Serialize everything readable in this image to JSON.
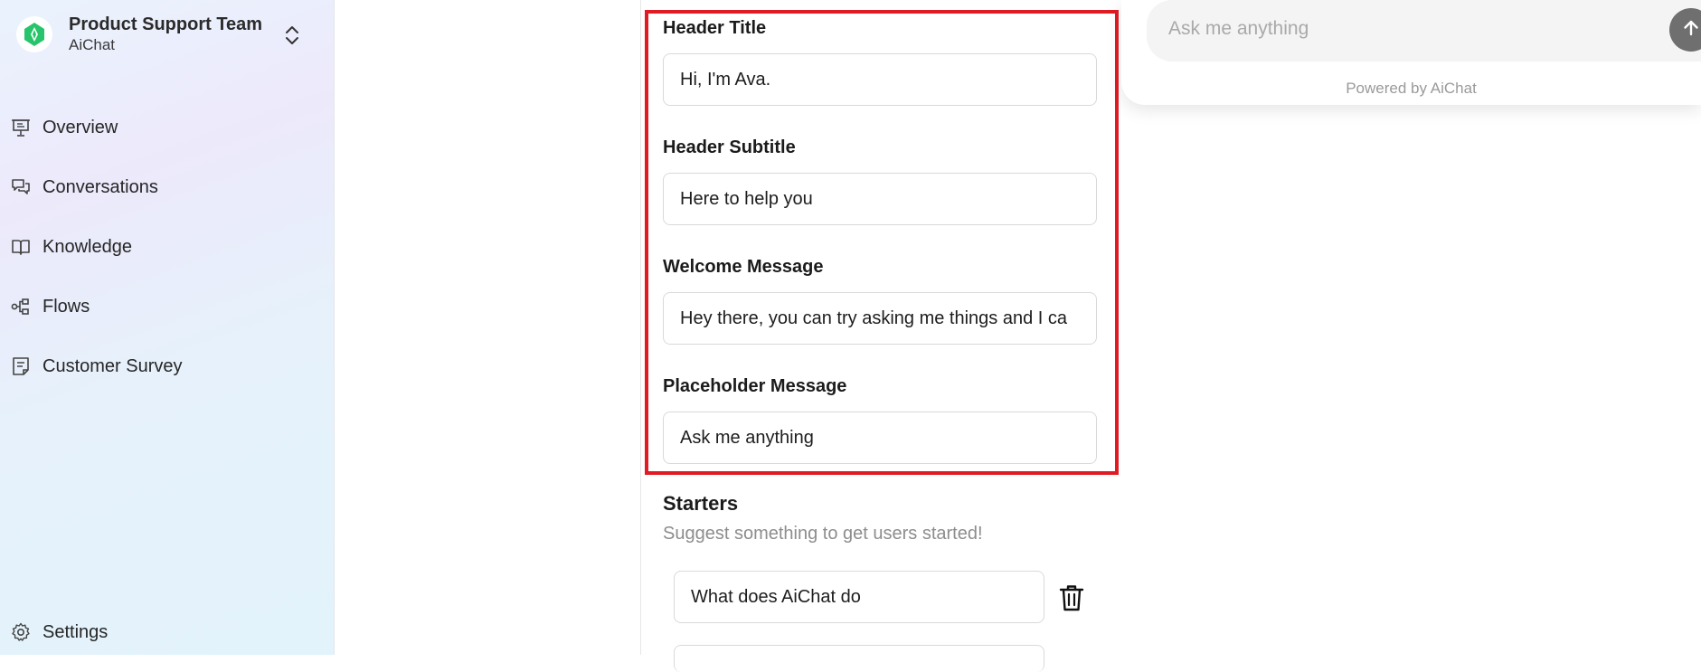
{
  "team": {
    "name": "Product Support Team",
    "app": "AiChat"
  },
  "nav": {
    "items": [
      {
        "label": "Overview",
        "icon": "presentation-icon"
      },
      {
        "label": "Conversations",
        "icon": "chat-bubbles-icon"
      },
      {
        "label": "Knowledge",
        "icon": "book-icon"
      },
      {
        "label": "Flows",
        "icon": "flow-icon"
      },
      {
        "label": "Customer Survey",
        "icon": "survey-icon"
      }
    ],
    "settings": {
      "label": "Settings",
      "icon": "gear-icon"
    }
  },
  "form": {
    "header_title": {
      "label": "Header Title",
      "value": "Hi, I'm Ava."
    },
    "header_subtitle": {
      "label": "Header Subtitle",
      "value": "Here to help you"
    },
    "welcome_message": {
      "label": "Welcome Message",
      "value": "Hey there, you can try asking me things and I ca"
    },
    "placeholder_message": {
      "label": "Placeholder Message",
      "value": "Ask me anything"
    }
  },
  "starters": {
    "title": "Starters",
    "subtitle": "Suggest something to get users started!",
    "items": [
      "What does AiChat do"
    ]
  },
  "preview": {
    "placeholder": "Ask me anything",
    "powered_by": "Powered by AiChat"
  },
  "colors": {
    "highlight": "#e01b24",
    "logo_green": "#2ecc71",
    "send_button": "#6f6f6f"
  }
}
